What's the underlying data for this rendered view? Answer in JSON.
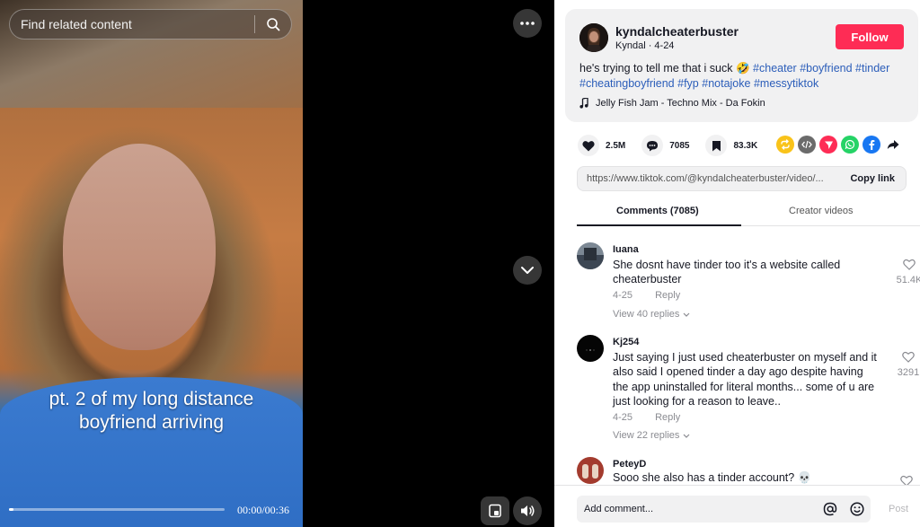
{
  "search": {
    "placeholder": "Find related content",
    "icon": "search-icon"
  },
  "video": {
    "caption_line1": "pt. 2 of my long distance",
    "caption_line2": "boyfriend arriving",
    "time": "00:00/00:36",
    "progress": 0.02
  },
  "author": {
    "username": "kyndalcheaterbuster",
    "display_name": "Kyndal",
    "date": "4-24",
    "sub_line": "Kyndal · 4-24",
    "follow_label": "Follow"
  },
  "description": {
    "text": "he's trying to tell me that i suck 🤣",
    "hashtags": [
      "#cheater",
      "#boyfriend",
      "#tinder",
      "#cheatingboyfriend",
      "#fyp",
      "#notajoke",
      "#messytiktok"
    ]
  },
  "music": {
    "title": "Jelly Fish Jam - Techno Mix - Da Fokin"
  },
  "stats": {
    "likes": "2.5M",
    "comments": "7085",
    "saves": "83.3K"
  },
  "share_colors": {
    "repost": "#f9c31a",
    "embed": "#6b6b6b",
    "send": "#fe2c55",
    "whatsapp": "#25d366",
    "facebook": "#1877f2"
  },
  "link": {
    "url": "https://www.tiktok.com/@kyndalcheaterbuster/video/...",
    "copy_label": "Copy link"
  },
  "tabs": {
    "comments": "Comments (7085)",
    "creator_videos": "Creator videos"
  },
  "comments": [
    {
      "user": "Iuana",
      "text": "She dosnt have tinder too it's a website called cheaterbuster",
      "date": "4-25",
      "reply": "Reply",
      "view_replies": "View 40 replies",
      "likes": "51.4K"
    },
    {
      "user": "Kj254",
      "text": "Just saying I just used cheaterbuster on myself and it also said I opened tinder a day ago despite having the app uninstalled for literal months... some of u are just looking for a reason to leave..",
      "date": "4-25",
      "reply": "Reply",
      "view_replies": "View 22 replies",
      "likes": "3291"
    },
    {
      "user": "PeteyD",
      "text": "Sooo she also has a tinder account? 💀",
      "likes": ""
    }
  ],
  "composer": {
    "placeholder": "Add comment...",
    "post_label": "Post"
  }
}
